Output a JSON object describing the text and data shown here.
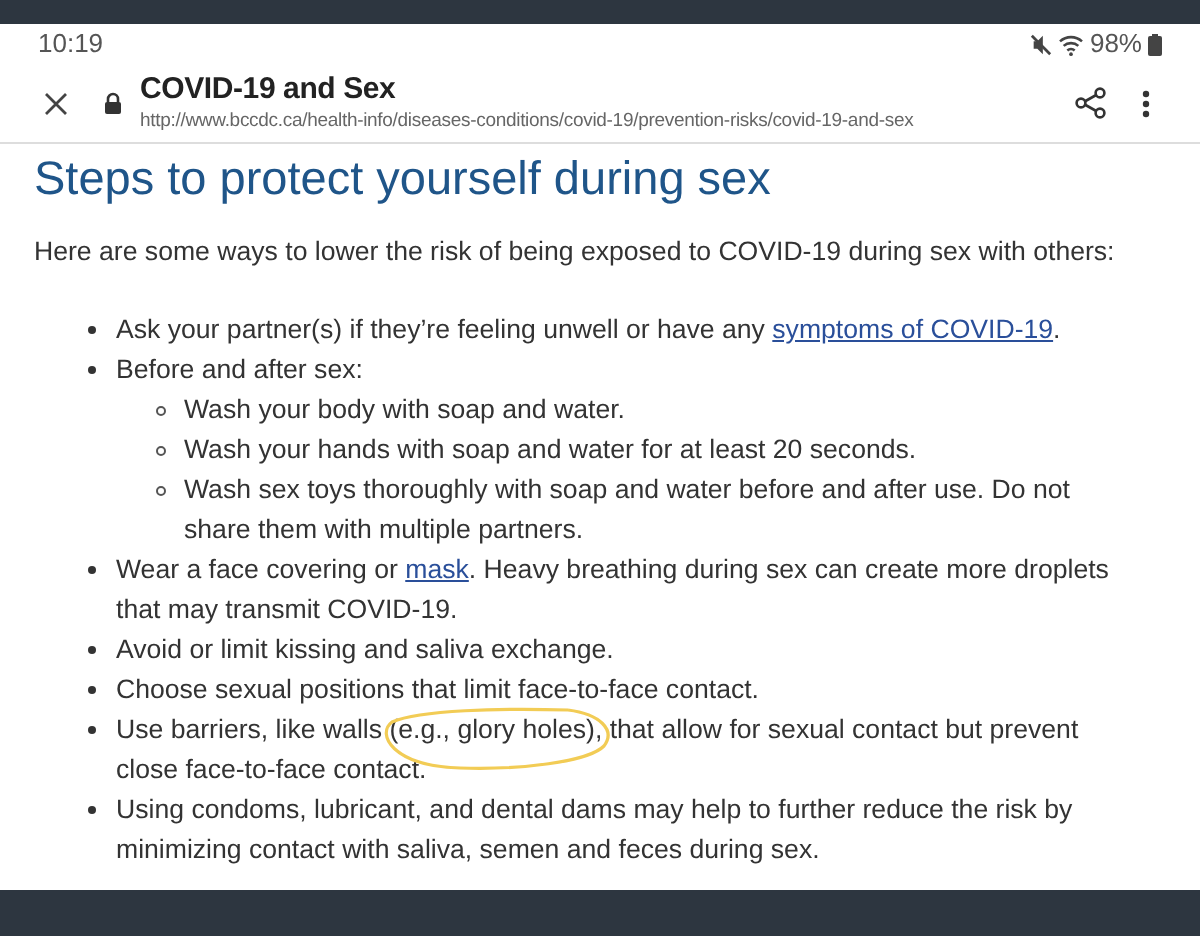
{
  "status_bar": {
    "time": "10:19",
    "battery": "98%"
  },
  "toolbar": {
    "title": "COVID-19 and Sex",
    "url": "http://www.bccdc.ca/health-info/diseases-conditions/covid-19/prevention-risks/covid-19-and-sex"
  },
  "heading": "Steps to protect yourself during sex",
  "intro": "Here are some ways to lower the risk of being exposed to COVID-19 during sex with others:",
  "items": [
    {
      "parts": [
        {
          "text": "Ask your partner(s) if they’re feeling unwell or have any "
        },
        {
          "text": "symptoms of COVID-19",
          "link": true
        },
        {
          "text": "."
        }
      ]
    },
    {
      "parts": [
        {
          "text": "Before and after sex:"
        }
      ],
      "children": [
        {
          "parts": [
            {
              "text": "Wash your body with soap and water."
            }
          ]
        },
        {
          "parts": [
            {
              "text": "Wash your hands with soap and water for at least 20 seconds."
            }
          ]
        },
        {
          "parts": [
            {
              "text": "Wash sex toys thoroughly with soap and water before and after use. Do not share them with multiple partners."
            }
          ]
        }
      ]
    },
    {
      "parts": [
        {
          "text": "Wear a face covering or "
        },
        {
          "text": "mask",
          "link": true
        },
        {
          "text": ". Heavy breathing during sex can create more droplets that may transmit COVID-19."
        }
      ]
    },
    {
      "parts": [
        {
          "text": "Avoid or limit kissing and saliva exchange."
        }
      ]
    },
    {
      "parts": [
        {
          "text": "Choose sexual positions that limit face-to-face contact."
        }
      ]
    },
    {
      "parts": [
        {
          "text": "Use barriers, like walls "
        },
        {
          "text": "(e.g., glory holes)",
          "circled": true
        },
        {
          "text": ", that allow for sexual contact but prevent close face-to-face contact."
        }
      ]
    },
    {
      "parts": [
        {
          "text": "Using condoms, lubricant, and dental dams may help to further reduce the risk by minimizing contact with saliva, semen and feces during sex."
        }
      ]
    }
  ]
}
